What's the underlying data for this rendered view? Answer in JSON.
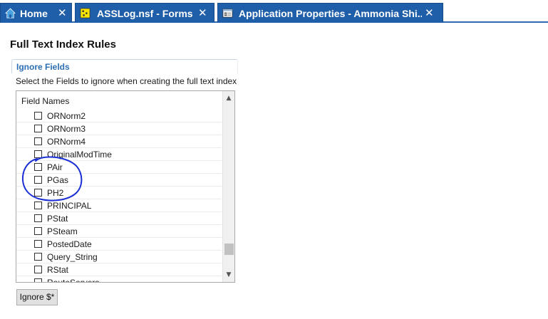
{
  "tabs": [
    {
      "label": "Home",
      "icon": "home-icon",
      "close": "✕"
    },
    {
      "label": "ASSLog.nsf - Forms",
      "icon": "database-icon",
      "close": "✕"
    },
    {
      "label": "Application Properties - Ammonia Shi...",
      "icon": "properties-icon",
      "close": "✕"
    }
  ],
  "page": {
    "title": "Full Text Index Rules"
  },
  "section": {
    "header": "Ignore Fields",
    "instruction": "Select the Fields to ignore when creating the full text index"
  },
  "list": {
    "header": "Field Names",
    "items": [
      {
        "label": "ORNorm2",
        "checked": false
      },
      {
        "label": "ORNorm3",
        "checked": false
      },
      {
        "label": "ORNorm4",
        "checked": false
      },
      {
        "label": "OriginalModTime",
        "checked": false
      },
      {
        "label": "PAir",
        "checked": false
      },
      {
        "label": "PGas",
        "checked": false
      },
      {
        "label": "PH2",
        "checked": false
      },
      {
        "label": "PRINCIPAL",
        "checked": false
      },
      {
        "label": "PStat",
        "checked": false
      },
      {
        "label": "PSteam",
        "checked": false
      },
      {
        "label": "PostedDate",
        "checked": false
      },
      {
        "label": "Query_String",
        "checked": false
      },
      {
        "label": "RStat",
        "checked": false
      },
      {
        "label": "RouteServers",
        "checked": false
      }
    ]
  },
  "buttons": {
    "ignore_label": "Ignore $*"
  },
  "colors": {
    "tab_background": "#1f5ea8",
    "section_header": "#2b6fb6",
    "annotation_ink": "#1a2fd6"
  }
}
